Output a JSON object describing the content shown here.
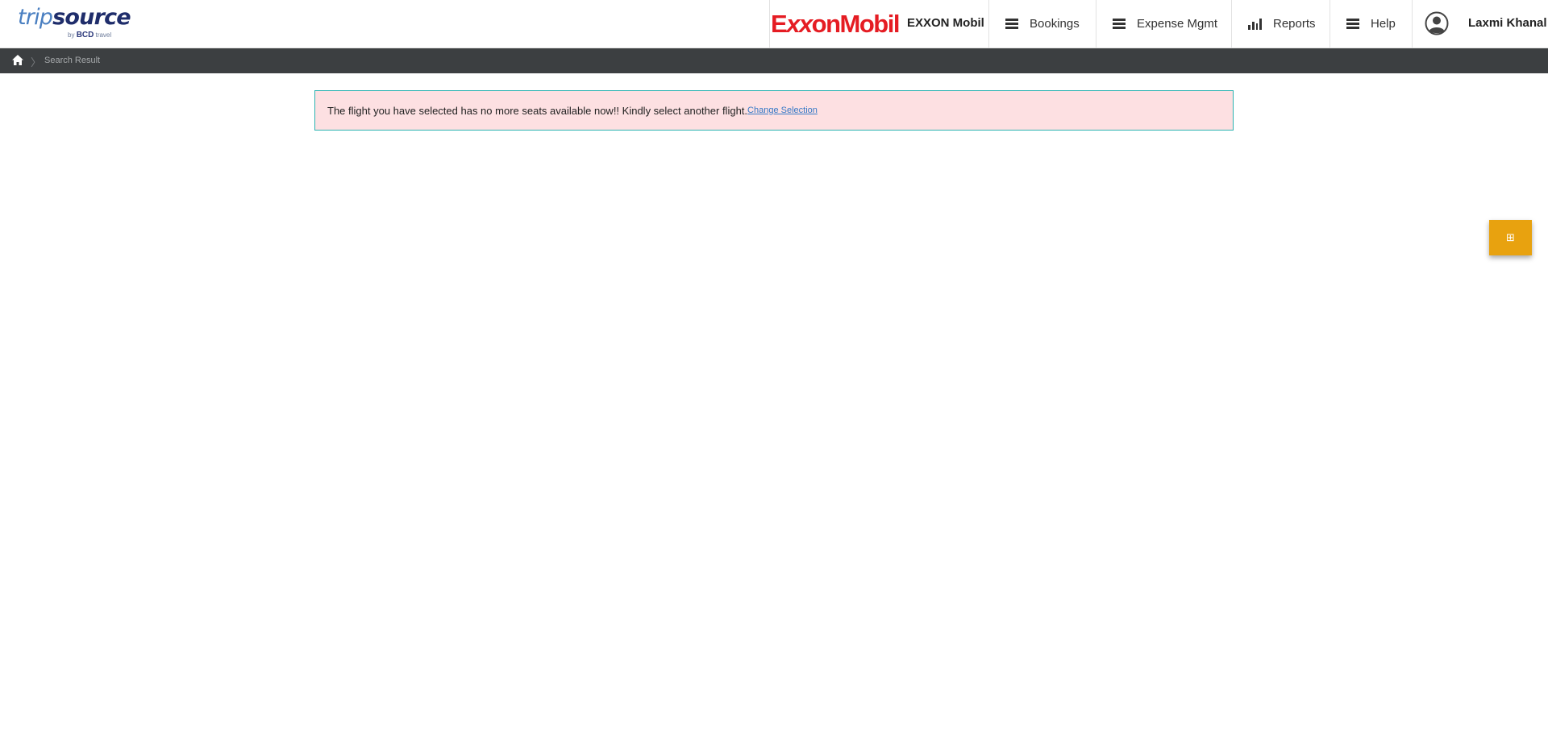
{
  "header": {
    "logo": {
      "main_trip": "trip",
      "main_source": "source",
      "sub_by": "by",
      "sub_bcd": "BCD",
      "sub_travel": "travel"
    },
    "company": {
      "logo_text_e": "E",
      "logo_text_xx": "xx",
      "logo_text_rest": "onMobil",
      "name": "EXXON Mobil"
    },
    "nav": [
      {
        "label": "Bookings",
        "icon": "menu-icon"
      },
      {
        "label": "Expense Mgmt",
        "icon": "menu-icon"
      },
      {
        "label": "Reports",
        "icon": "bar-chart-icon"
      },
      {
        "label": "Help",
        "icon": "menu-icon"
      }
    ],
    "user": {
      "name": "Laxmi Khanal",
      "icon": "user-avatar-icon"
    }
  },
  "breadcrumb": {
    "home_icon": "home-icon",
    "current": "Search Result"
  },
  "alert": {
    "message": "The flight you have selected has no more seats available now!! Kindly select another flight.",
    "link_label": "Change Selection",
    "colors": {
      "background": "#fde0e2",
      "border": "#2bb3b1",
      "link": "#3478c6"
    }
  },
  "floating_widget": {
    "icon": "grid-icon",
    "glyph": "⊞",
    "color": "#e8a20f"
  },
  "colors": {
    "brand_red": "#e51c23",
    "breadcrumb_bg": "#3c3f41"
  }
}
